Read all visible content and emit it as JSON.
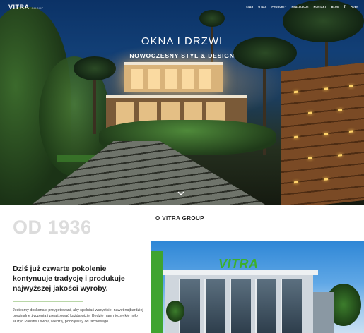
{
  "header": {
    "logo": "VITRA",
    "logo_tag": "GROUP",
    "nav": [
      "STAR",
      "O NAS",
      "PRODUKTY",
      "REALIZACJE",
      "KONTAKT",
      "BLOG",
      "f",
      "PL/EN"
    ]
  },
  "hero": {
    "title": "OKNA I DRZWI",
    "subtitle": "NOWOCZESNY STYL & DESIGN",
    "scroll_icon": "chevron-down-icon"
  },
  "about": {
    "year": "OD 1936",
    "label": "O VITRA GROUP",
    "heading": "Dziś już czwarte pokolenie kontynuuje tradycję i produkuje najwyższej jakości wyroby.",
    "paragraph": "Jesteśmy doskonale przygotowani, aby spełniać wszystkie, nawet najbardziej oryginalne życzenia i zrealizować każdą wizję. Będzie nam niezwykle miło służyć Państwu swoją wiedzą, począwszy od fachowego",
    "building_sign": "VITRA"
  },
  "colors": {
    "accent": "#3fa430",
    "heading": "#1d1d1d",
    "year": "#dcdcdc"
  }
}
